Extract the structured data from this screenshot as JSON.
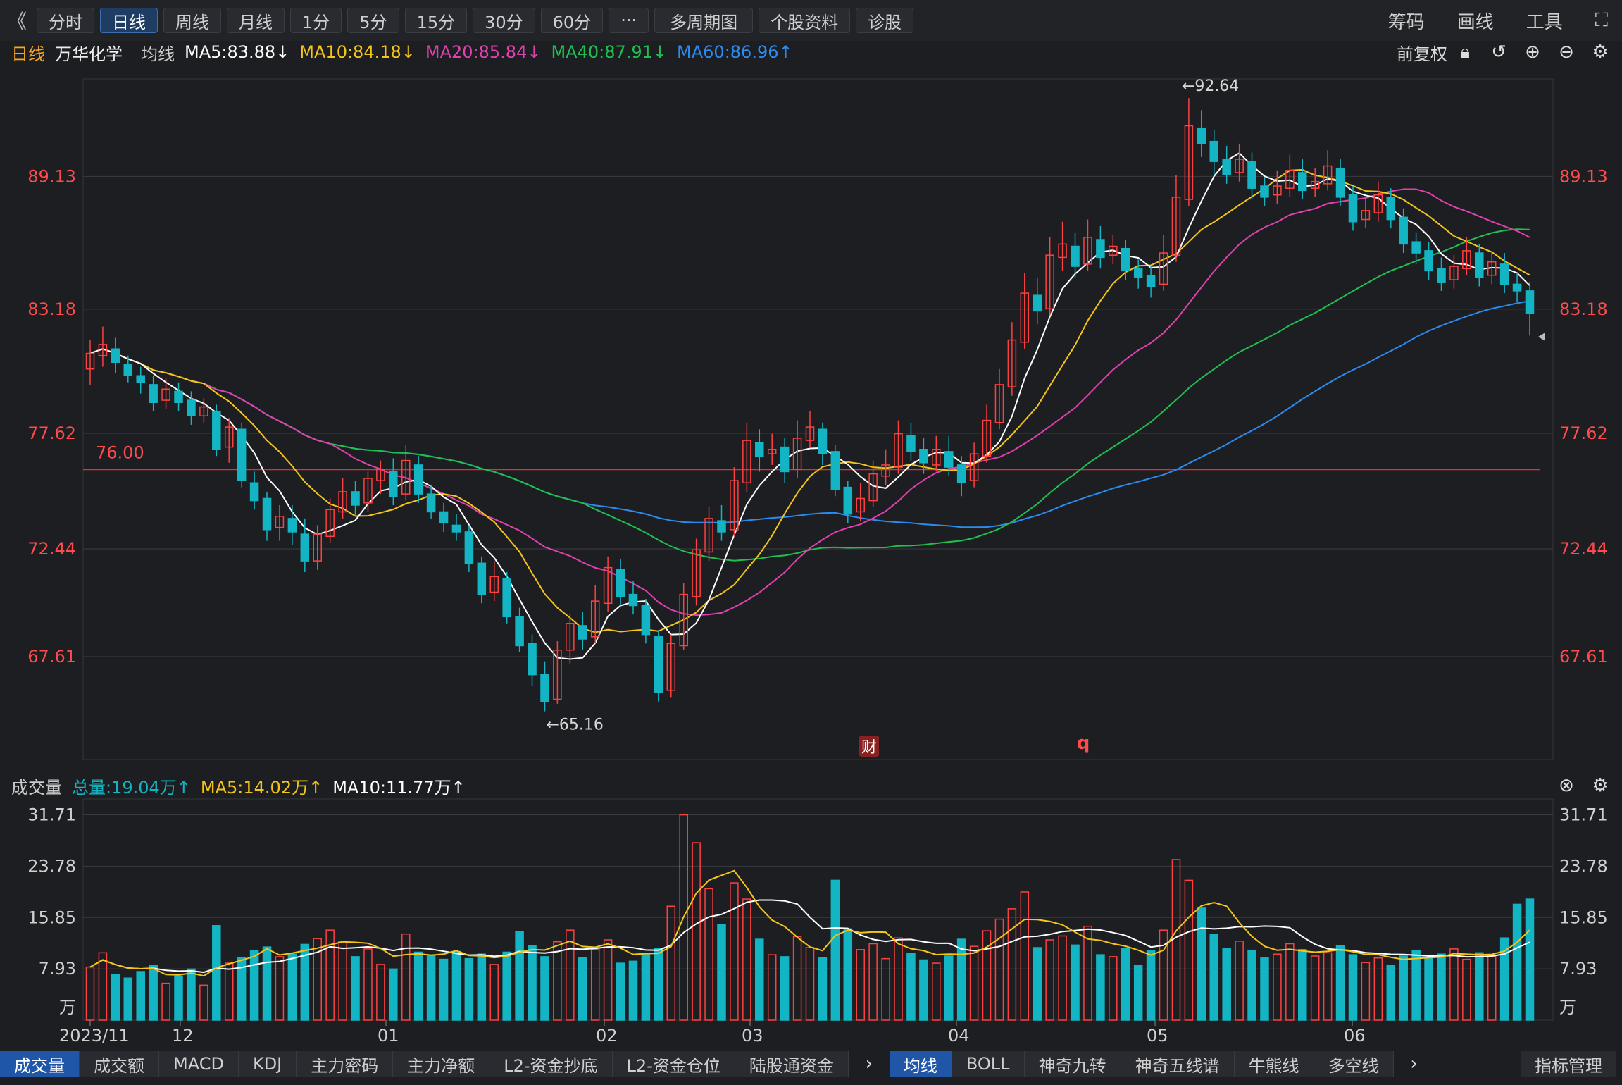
{
  "toolbar": {
    "back_label": "《",
    "tabs": [
      "分时",
      "日线",
      "周线",
      "月线",
      "1分",
      "5分",
      "15分",
      "30分",
      "60分",
      "···",
      "多周期图",
      "个股资料",
      "诊股"
    ],
    "active_tab": 1,
    "right_links": [
      "筹码",
      "画线",
      "工具"
    ]
  },
  "ma_bar": {
    "period": "日线",
    "stock": "万华化学",
    "label": "均线",
    "ma5": "MA5:83.88↓",
    "ma10": "MA10:84.18↓",
    "ma20": "MA20:85.84↓",
    "ma40": "MA40:87.91↓",
    "ma60": "MA60:86.96↑",
    "adjust": "前复权"
  },
  "price_axis": {
    "ticks": [
      "89.13",
      "83.18",
      "77.62",
      "72.44",
      "67.61"
    ]
  },
  "price_annotations": {
    "high": "←92.64",
    "low": "←65.16",
    "line_label": "76.00",
    "cai": "财",
    "q": "q"
  },
  "volume_bar": {
    "title": "成交量",
    "total": "总量:19.04万↑",
    "ma5": "MA5:14.02万↑",
    "ma10": "MA10:11.77万↑"
  },
  "volume_axis": {
    "ticks": [
      "31.71",
      "23.78",
      "15.85",
      "7.93"
    ],
    "unit": "万"
  },
  "date_axis": {
    "labels": [
      "2023/11",
      "12",
      "01",
      "02",
      "03",
      "04",
      "05",
      "06"
    ]
  },
  "indicator_tabs": [
    "成交量",
    "成交额",
    "MACD",
    "KDJ",
    "主力密码",
    "主力净额",
    "L2-资金抄底",
    "L2-资金仓位",
    "陆股通资金"
  ],
  "ma_tabs": [
    "均线",
    "BOLL",
    "神奇九转",
    "神奇五线谱",
    "牛熊线",
    "多空线"
  ],
  "indicator_manage": "指标管理",
  "colors": {
    "up": "#ff4040",
    "down": "#13b5c4",
    "ma5": "#ffffff",
    "ma10": "#f5c518",
    "ma20": "#e040b0",
    "ma40": "#20c050",
    "ma60": "#2a8cf0"
  },
  "chart_data": {
    "type": "candlestick",
    "price_range": [
      63.0,
      93.5
    ],
    "volume_range": [
      0,
      33.5
    ],
    "support_line": 76.0,
    "candles": [
      [
        80.5,
        81.2,
        81.8,
        79.8,
        8.2
      ],
      [
        81.1,
        81.6,
        82.4,
        80.6,
        10.4
      ],
      [
        81.4,
        80.8,
        81.9,
        80.3,
        7.1
      ],
      [
        80.7,
        80.2,
        81.1,
        79.9,
        6.5
      ],
      [
        80.2,
        79.9,
        80.6,
        79.4,
        7.5
      ],
      [
        79.8,
        79.0,
        80.2,
        78.6,
        8.4
      ],
      [
        79.1,
        79.6,
        80.1,
        78.7,
        5.7
      ],
      [
        79.5,
        79.0,
        79.9,
        78.6,
        6.8
      ],
      [
        79.1,
        78.4,
        79.5,
        78.0,
        7.9
      ],
      [
        78.4,
        78.8,
        79.2,
        78.1,
        5.4
      ],
      [
        78.6,
        76.9,
        78.9,
        76.6,
        14.6
      ],
      [
        77.0,
        77.9,
        78.3,
        76.3,
        8.8
      ],
      [
        77.8,
        75.5,
        78.1,
        75.2,
        9.6
      ],
      [
        75.4,
        74.6,
        75.9,
        74.2,
        10.8
      ],
      [
        74.7,
        73.3,
        75.0,
        72.8,
        11.3
      ],
      [
        73.4,
        73.9,
        74.4,
        72.8,
        9.8
      ],
      [
        73.8,
        73.2,
        74.4,
        72.6,
        10.2
      ],
      [
        73.1,
        71.9,
        73.8,
        71.4,
        11.7
      ],
      [
        71.9,
        73.1,
        73.5,
        71.5,
        12.6
      ],
      [
        73.0,
        74.2,
        74.7,
        72.7,
        13.9
      ],
      [
        74.1,
        75.0,
        75.6,
        73.8,
        12.1
      ],
      [
        75.0,
        74.4,
        75.5,
        73.9,
        9.8
      ],
      [
        74.5,
        75.6,
        75.9,
        74.1,
        11.0
      ],
      [
        75.5,
        76.0,
        76.4,
        74.9,
        8.6
      ],
      [
        75.9,
        74.8,
        76.5,
        74.4,
        7.9
      ],
      [
        74.9,
        76.4,
        77.1,
        74.6,
        13.3
      ],
      [
        76.2,
        74.9,
        76.6,
        74.5,
        10.5
      ],
      [
        74.9,
        74.1,
        75.3,
        73.8,
        9.9
      ],
      [
        74.1,
        73.6,
        74.5,
        73.2,
        9.4
      ],
      [
        73.5,
        73.2,
        74.0,
        72.8,
        10.6
      ],
      [
        73.2,
        71.8,
        73.5,
        71.4,
        9.5
      ],
      [
        71.8,
        70.4,
        72.1,
        70.0,
        10.2
      ],
      [
        70.5,
        71.2,
        71.9,
        70.1,
        8.6
      ],
      [
        71.1,
        69.4,
        71.4,
        69.1,
        10.5
      ],
      [
        69.4,
        68.1,
        69.8,
        67.8,
        13.7
      ],
      [
        68.2,
        66.8,
        68.6,
        66.3,
        11.5
      ],
      [
        66.8,
        65.6,
        67.4,
        65.16,
        9.8
      ],
      [
        65.7,
        67.9,
        68.3,
        65.5,
        12.1
      ],
      [
        67.9,
        69.1,
        69.5,
        67.3,
        13.9
      ],
      [
        69.0,
        68.4,
        69.6,
        67.9,
        9.6
      ],
      [
        68.5,
        70.1,
        70.8,
        68.2,
        10.9
      ],
      [
        70.0,
        71.6,
        72.1,
        69.6,
        12.4
      ],
      [
        71.5,
        70.3,
        72.0,
        69.9,
        8.8
      ],
      [
        70.4,
        69.9,
        71.0,
        69.5,
        9.1
      ],
      [
        69.9,
        68.6,
        70.2,
        68.2,
        10.2
      ],
      [
        68.5,
        66.0,
        68.8,
        65.6,
        11.1
      ],
      [
        66.1,
        68.2,
        68.6,
        65.8,
        17.6
      ],
      [
        68.1,
        70.4,
        70.9,
        67.9,
        31.7
      ],
      [
        70.3,
        72.4,
        72.9,
        69.9,
        27.4
      ],
      [
        72.3,
        73.8,
        74.3,
        71.9,
        20.3
      ],
      [
        73.7,
        73.2,
        74.4,
        72.8,
        14.8
      ],
      [
        73.3,
        75.5,
        76.1,
        73.0,
        21.2
      ],
      [
        75.4,
        77.3,
        78.1,
        75.0,
        18.7
      ],
      [
        77.2,
        76.6,
        77.8,
        75.9,
        12.5
      ],
      [
        76.7,
        76.9,
        77.6,
        76.2,
        10.1
      ],
      [
        77.0,
        75.9,
        77.4,
        75.4,
        9.8
      ],
      [
        76.0,
        77.4,
        78.2,
        75.6,
        12.9
      ],
      [
        77.3,
        77.9,
        78.6,
        77.0,
        11.2
      ],
      [
        77.8,
        76.7,
        78.1,
        76.2,
        9.7
      ],
      [
        76.8,
        75.1,
        77.1,
        74.8,
        21.6
      ],
      [
        75.2,
        74.0,
        75.5,
        73.6,
        14.1
      ],
      [
        74.1,
        74.7,
        75.4,
        73.7,
        10.9
      ],
      [
        74.6,
        75.8,
        76.4,
        74.3,
        11.8
      ],
      [
        75.7,
        76.2,
        76.9,
        75.3,
        9.5
      ],
      [
        76.1,
        77.6,
        78.2,
        75.8,
        12.7
      ],
      [
        77.5,
        76.8,
        78.1,
        76.4,
        10.3
      ],
      [
        76.9,
        76.3,
        77.4,
        75.8,
        9.3
      ],
      [
        76.2,
        76.9,
        77.5,
        75.9,
        8.8
      ],
      [
        76.8,
        76.1,
        77.5,
        75.7,
        9.9
      ],
      [
        76.2,
        75.4,
        76.6,
        74.8,
        12.5
      ],
      [
        75.5,
        76.7,
        77.2,
        75.2,
        11.4
      ],
      [
        76.6,
        78.2,
        78.9,
        76.3,
        13.8
      ],
      [
        78.1,
        79.8,
        80.5,
        77.8,
        15.6
      ],
      [
        79.7,
        81.8,
        82.6,
        79.3,
        17.2
      ],
      [
        81.7,
        83.9,
        84.8,
        81.4,
        19.8
      ],
      [
        83.8,
        83.1,
        84.6,
        82.5,
        11.2
      ],
      [
        83.2,
        85.6,
        86.4,
        82.9,
        12.4
      ],
      [
        85.5,
        86.1,
        87.1,
        84.9,
        13.0
      ],
      [
        86.0,
        85.1,
        86.6,
        84.6,
        11.6
      ],
      [
        85.2,
        86.4,
        87.2,
        84.9,
        14.5
      ],
      [
        86.3,
        85.5,
        86.9,
        85.0,
        10.1
      ],
      [
        85.6,
        86.0,
        86.5,
        85.2,
        9.8
      ],
      [
        85.9,
        84.9,
        86.3,
        84.5,
        11.1
      ],
      [
        85.0,
        84.6,
        85.4,
        84.1,
        8.5
      ],
      [
        84.7,
        84.2,
        85.1,
        83.7,
        10.7
      ],
      [
        84.3,
        85.7,
        86.5,
        84.0,
        13.9
      ],
      [
        85.6,
        88.2,
        89.2,
        85.3,
        24.8
      ],
      [
        88.1,
        91.4,
        92.64,
        87.8,
        21.6
      ],
      [
        91.3,
        90.6,
        92.1,
        90.0,
        17.3
      ],
      [
        90.7,
        89.8,
        91.2,
        89.2,
        13.2
      ],
      [
        89.9,
        89.2,
        90.5,
        88.8,
        11.1
      ],
      [
        89.3,
        89.9,
        90.6,
        88.9,
        12.2
      ],
      [
        89.8,
        88.6,
        90.2,
        88.1,
        10.8
      ],
      [
        88.7,
        88.2,
        89.1,
        87.8,
        9.7
      ],
      [
        88.3,
        88.7,
        89.4,
        87.9,
        10.2
      ],
      [
        88.6,
        89.4,
        90.1,
        88.2,
        11.8
      ],
      [
        89.3,
        88.5,
        89.9,
        88.1,
        10.9
      ],
      [
        88.6,
        88.9,
        89.5,
        88.2,
        9.9
      ],
      [
        88.8,
        89.6,
        90.3,
        88.5,
        10.4
      ],
      [
        89.5,
        88.2,
        89.9,
        87.8,
        11.5
      ],
      [
        88.3,
        87.1,
        88.7,
        86.7,
        10.1
      ],
      [
        87.2,
        87.6,
        88.1,
        86.8,
        8.9
      ],
      [
        87.5,
        88.3,
        88.9,
        87.1,
        9.6
      ],
      [
        88.2,
        87.2,
        88.6,
        86.8,
        8.4
      ],
      [
        87.3,
        86.1,
        87.7,
        85.7,
        9.9
      ],
      [
        86.2,
        85.7,
        86.6,
        85.2,
        10.8
      ],
      [
        85.8,
        84.9,
        86.2,
        84.5,
        9.5
      ],
      [
        85.0,
        84.4,
        85.5,
        84.0,
        10.2
      ],
      [
        84.5,
        85.1,
        85.6,
        84.1,
        11.0
      ],
      [
        85.0,
        85.8,
        86.4,
        84.7,
        9.4
      ],
      [
        85.7,
        84.6,
        86.1,
        84.2,
        10.4
      ],
      [
        84.7,
        85.3,
        85.8,
        84.3,
        9.8
      ],
      [
        85.2,
        84.3,
        85.7,
        83.9,
        12.7
      ],
      [
        84.3,
        84.0,
        84.8,
        83.5,
        17.9
      ],
      [
        84.0,
        83.0,
        84.4,
        82.0,
        18.7
      ]
    ]
  }
}
